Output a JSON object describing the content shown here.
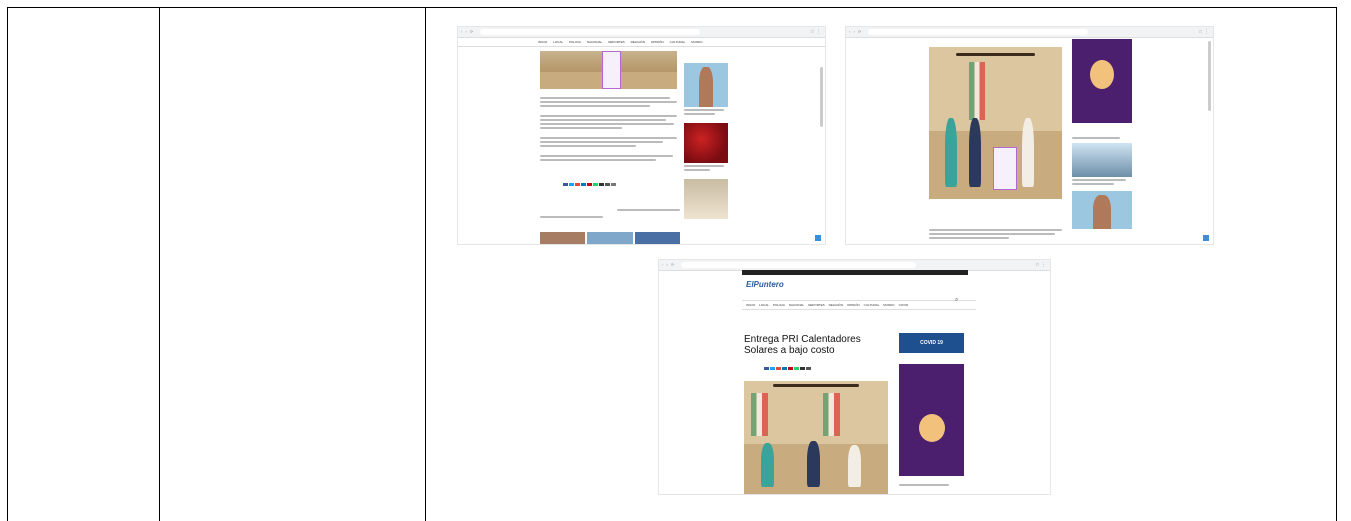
{
  "screenshot_top_left": {
    "nav_items": [
      "INICIO",
      "LOCAL",
      "POLICIA",
      "NACIONAL",
      "DEPORTES",
      "RELIGIÓN",
      "OPINIÓN",
      "CULTURAL",
      "MUNDO"
    ]
  },
  "screenshot_bottom": {
    "site_logo": "ElPuntero",
    "nav_items": [
      "INICIO",
      "LOCAL",
      "POLICIA",
      "NACIONAL",
      "DEPORTES",
      "RELIGIÓN",
      "OPINIÓN",
      "CULTURAL",
      "MUNDO",
      "COVID"
    ],
    "headline": "Entrega PRI Calentadores Solares a bajo costo",
    "covid_banner": "COVID 19"
  },
  "colors": {
    "border": "#000000",
    "poster_purple": "#4b1e6e",
    "accent_blue": "#3b8fd9",
    "covid_banner": "#1e4f8f"
  }
}
